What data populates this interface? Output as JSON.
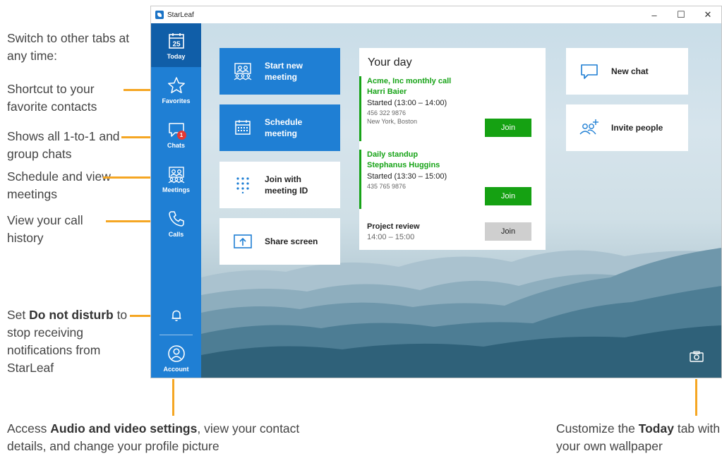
{
  "annotations": {
    "tabs": "Switch to other tabs at any time:",
    "favorites": "Shortcut to your favorite contacts",
    "chats": "Shows all 1-to-1 and group chats",
    "meetings": "Schedule and view meetings",
    "calls": "View your call history",
    "dnd_pre": "Set ",
    "dnd_bold": "Do not disturb",
    "dnd_post": " to stop receiving notifications from StarLeaf",
    "account_pre": "Access ",
    "account_bold": "Audio and video settings",
    "account_post": ", view your contact details, and change your profile picture",
    "wallpaper_pre": "Customize the ",
    "wallpaper_bold": "Today",
    "wallpaper_post": " tab with your own wallpaper",
    "accent_color": "#f5a623"
  },
  "window": {
    "title": "StarLeaf",
    "controls": {
      "minimize": "–",
      "maximize": "☐",
      "close": "✕"
    }
  },
  "sidebar": {
    "color": "#1f7fd4",
    "items": [
      {
        "label": "Today",
        "icon": "calendar-icon",
        "date": "25",
        "active": true
      },
      {
        "label": "Favorites",
        "icon": "star-icon"
      },
      {
        "label": "Chats",
        "icon": "chat-icon",
        "badge": "1"
      },
      {
        "label": "Meetings",
        "icon": "meetings-icon"
      },
      {
        "label": "Calls",
        "icon": "phone-icon"
      }
    ],
    "bottom": [
      {
        "label": "",
        "icon": "bell-icon"
      },
      {
        "label": "Account",
        "icon": "account-icon"
      }
    ]
  },
  "tiles": {
    "start_meeting": "Start new\nmeeting",
    "schedule_meeting": "Schedule\nmeeting",
    "join_meeting_id": "Join with\nmeeting ID",
    "share_screen": "Share screen",
    "new_chat": "New chat",
    "invite_people": "Invite people"
  },
  "your_day": {
    "title": "Your day",
    "meetings": [
      {
        "name": "Acme, Inc monthly call",
        "host": "Harri Baier",
        "status": "Started (13:00 – 14:00)",
        "phone": "456 322 9876",
        "location": "New York, Boston",
        "join_label": "Join",
        "state": "started"
      },
      {
        "name": "Daily standup",
        "host": "Stephanus Huggins",
        "status": "Started (13:30 – 15:00)",
        "phone": "435 765 9876",
        "join_label": "Join",
        "state": "started"
      },
      {
        "name": "Project review",
        "time": "14:00 – 15:00",
        "join_label": "Join",
        "state": "upcoming"
      }
    ]
  }
}
